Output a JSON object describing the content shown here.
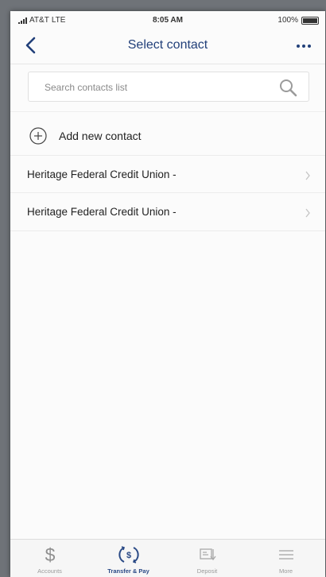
{
  "status_bar": {
    "carrier": "AT&T",
    "network": "LTE",
    "time": "8:05 AM",
    "battery": "100%"
  },
  "header": {
    "title": "Select contact",
    "back_icon": "chevron-left-icon",
    "more_icon": "ellipsis-icon"
  },
  "search": {
    "placeholder": "Search contacts list",
    "value": "",
    "icon": "search-icon"
  },
  "add_contact": {
    "label": "Add new contact",
    "icon": "plus-circle-icon"
  },
  "contacts": [
    {
      "name": "Heritage Federal Credit Union -"
    },
    {
      "name": "Heritage Federal Credit Union -"
    }
  ],
  "tab_bar": {
    "tabs": [
      {
        "label": "Accounts",
        "icon": "dollar-icon",
        "active": false
      },
      {
        "label": "Transfer & Pay",
        "icon": "transfer-icon",
        "active": true
      },
      {
        "label": "Deposit",
        "icon": "check-deposit-icon",
        "active": false
      },
      {
        "label": "More",
        "icon": "menu-icon",
        "active": false
      }
    ]
  },
  "colors": {
    "accent": "#22407a",
    "background": "#fbfbfb",
    "muted": "#9a9a9a"
  }
}
